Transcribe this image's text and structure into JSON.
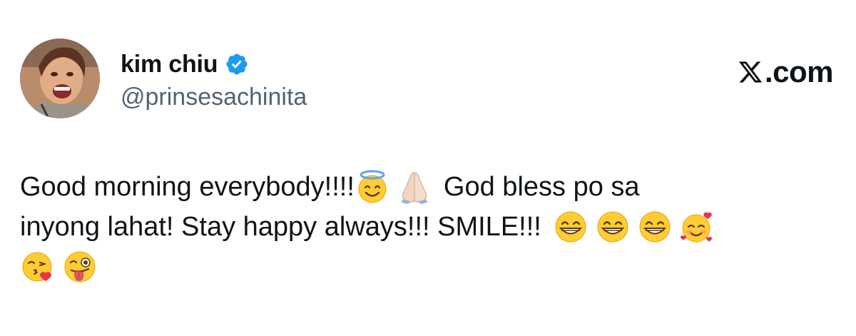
{
  "author": {
    "display_name": "kim chiu",
    "handle": "@prinsesachinita",
    "verified": true,
    "avatar": "profile-photo"
  },
  "brand": {
    "label": ".com",
    "icon": "x-logo-icon"
  },
  "tweet": {
    "line1_text_a": "Good morning everybody!!!!",
    "line1_text_b": "God bless po sa",
    "line2_text": "inyong lahat! Stay happy always!!! SMILE!!!",
    "emojis_line1": [
      "smiling-face-with-halo",
      "folded-hands"
    ],
    "emojis_line2": [
      "grinning-face-with-smiling-eyes",
      "grinning-face-with-smiling-eyes",
      "grinning-face-with-smiling-eyes",
      "smiling-face-with-hearts"
    ],
    "emojis_line3": [
      "face-blowing-a-kiss",
      "winking-face-with-tongue"
    ]
  },
  "colors": {
    "text": "#0f1419",
    "secondary_text": "#536471",
    "verified_blue": "#1d9bf0",
    "emoji_yellow": "#ffcc33",
    "background": "#ffffff"
  }
}
